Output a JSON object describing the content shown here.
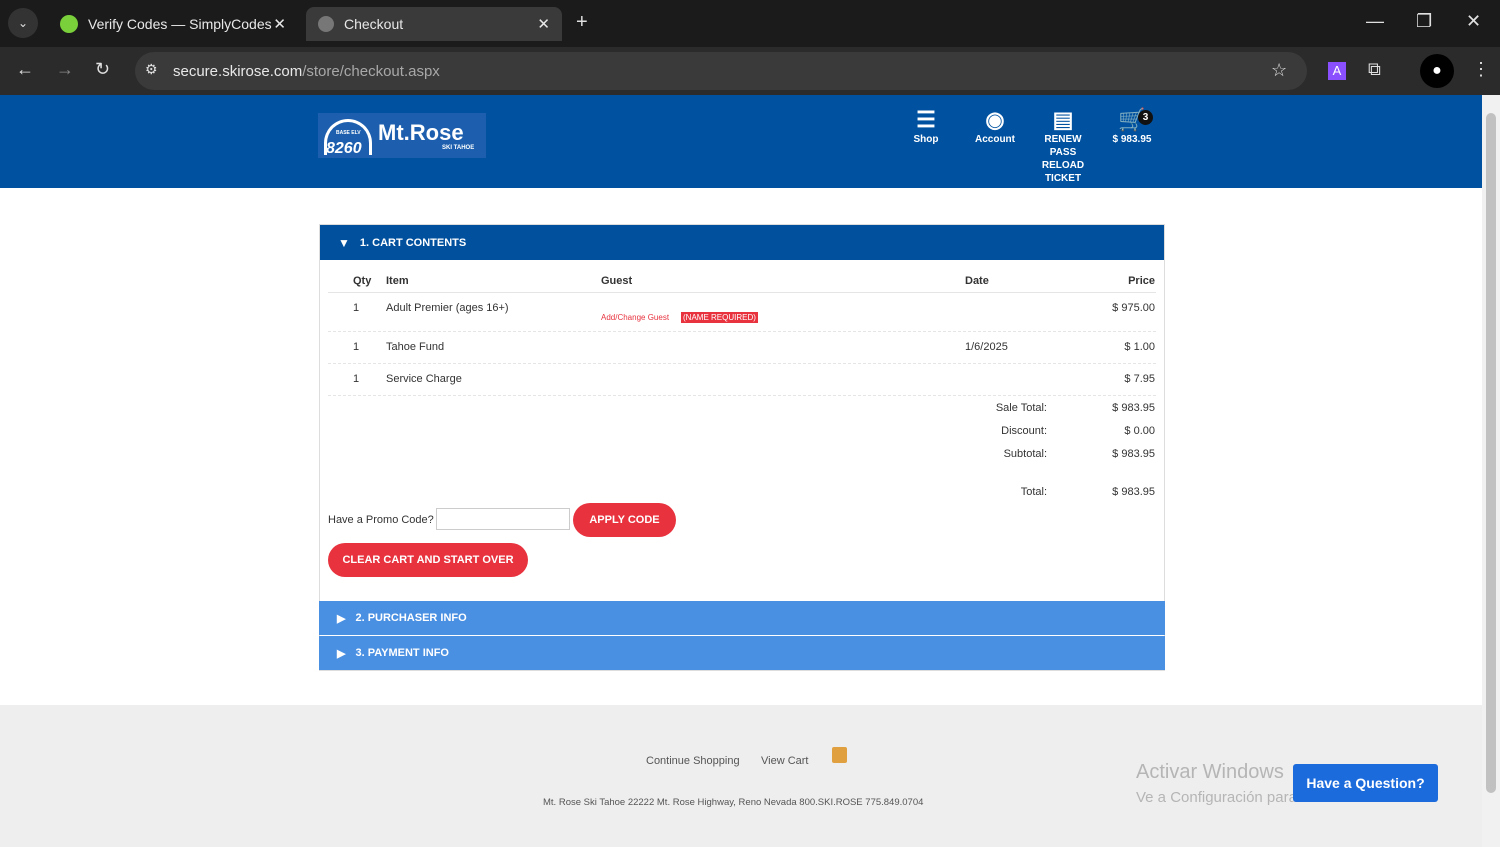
{
  "browser": {
    "tabs": [
      {
        "title": "Verify Codes — SimplyCodes"
      },
      {
        "title": "Checkout"
      }
    ],
    "url_domain": "secure.skirose.com",
    "url_path": "/store/checkout.aspx"
  },
  "header": {
    "logo": {
      "name": "Mt.Rose",
      "sub": "SKI TAHOE",
      "elev": "8260",
      "base": "BASE ELV"
    },
    "nav": [
      {
        "label": "Shop"
      },
      {
        "label": "Account"
      },
      {
        "label": "RENEW PASS RELOAD TICKET"
      },
      {
        "label": "$ 983.95",
        "badge": "3"
      }
    ]
  },
  "cart": {
    "title": "1. CART CONTENTS",
    "columns": [
      "Qty",
      "Item",
      "Guest",
      "Date",
      "Price"
    ],
    "rows": [
      {
        "qty": "1",
        "item": "Adult Premier (ages 16+)",
        "guest_link": "Add/Change Guest",
        "guest_flag": "(NAME REQUIRED)",
        "date": "",
        "price": "$ 975.00"
      },
      {
        "qty": "1",
        "item": "Tahoe Fund",
        "date": "1/6/2025",
        "price": "$ 1.00"
      },
      {
        "qty": "1",
        "item": "Service Charge",
        "date": "",
        "price": "$ 7.95"
      }
    ],
    "totals": [
      {
        "label": "Sale Total:",
        "value": "$ 983.95"
      },
      {
        "label": "Discount:",
        "value": "$ 0.00"
      },
      {
        "label": "Subtotal:",
        "value": "$ 983.95"
      },
      {
        "label": "Total:",
        "value": "$ 983.95"
      }
    ],
    "promo_label": "Have a Promo Code?",
    "promo_value": "",
    "apply": "APPLY CODE",
    "clear": "CLEAR CART AND START OVER"
  },
  "sections": [
    "2. PURCHASER INFO",
    "3. PAYMENT INFO"
  ],
  "footer": {
    "links": [
      "Continue Shopping",
      "View Cart"
    ],
    "address": "Mt. Rose Ski Tahoe 22222 Mt. Rose Highway, Reno Nevada 800.SKI.ROSE 775.849.0704"
  },
  "watermark": {
    "line1": "Activar Windows",
    "line2": "Ve a Configuración para activar Windows."
  },
  "chat": "Have a Question?",
  "colors": {
    "brand": "#0052a1",
    "accent": "#e8333f",
    "section": "#4a90e2"
  }
}
